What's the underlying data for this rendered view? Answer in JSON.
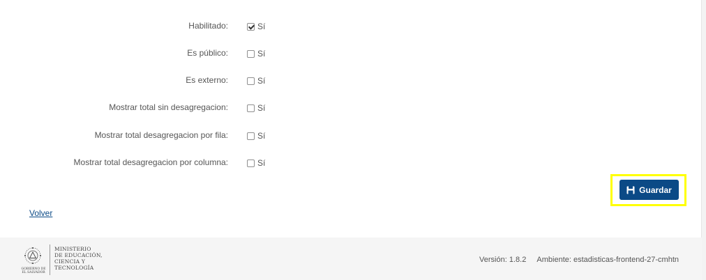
{
  "form": {
    "rows": [
      {
        "label": "Habilitado:",
        "checkbox_text": "Sí",
        "checked": true
      },
      {
        "label": "Es público:",
        "checkbox_text": "Sí",
        "checked": false
      },
      {
        "label": "Es externo:",
        "checkbox_text": "Sí",
        "checked": false
      },
      {
        "label": "Mostrar total sin desagregacion:",
        "checkbox_text": "Sí",
        "checked": false
      },
      {
        "label": "Mostrar total desagregacion por fila:",
        "checkbox_text": "Sí",
        "checked": false
      },
      {
        "label": "Mostrar total desagregacion por columna:",
        "checkbox_text": "Sí",
        "checked": false
      }
    ],
    "save_button": {
      "label": "Guardar",
      "icon": "floppy-disk-icon",
      "color": "#0b4a86"
    },
    "highlight_color": "#ffff00"
  },
  "back_link": {
    "label": "Volver"
  },
  "footer": {
    "logo": {
      "lines": [
        "MINISTERIO",
        "DE EDUCACIÓN,",
        "CIENCIA Y",
        "TECNOLOGÍA"
      ],
      "seal_caption": "GOBIERNO DE EL SALVADOR"
    },
    "version": "Versión: 1.8.2",
    "environment": "Ambiente: estadisticas-frontend-27-cmhtn"
  }
}
